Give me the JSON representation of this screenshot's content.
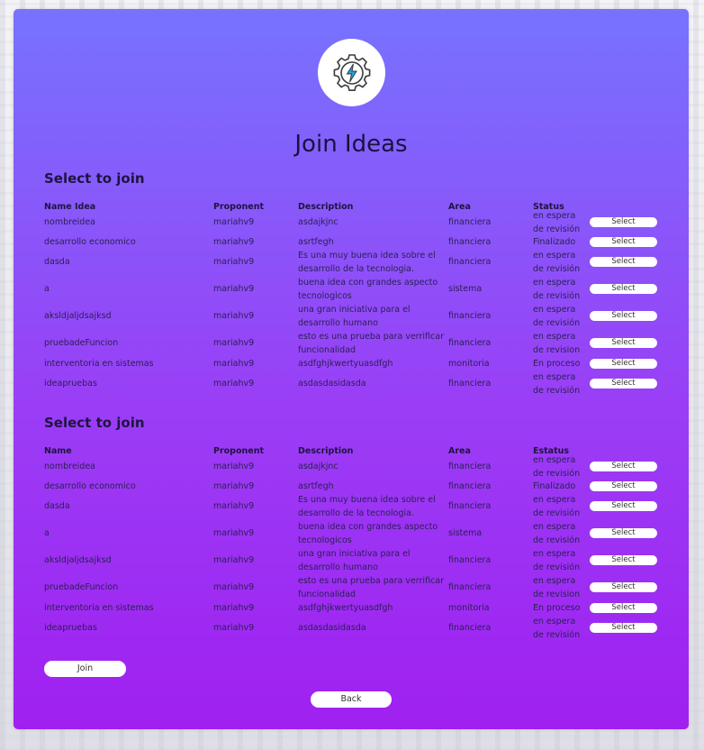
{
  "page_title": "Join Ideas",
  "sections": [
    {
      "title": "Select to join",
      "headers": [
        "Name Idea",
        "Proponent",
        "Description",
        "Area",
        "Status"
      ],
      "rows": [
        {
          "name": "nombreidea",
          "proponent": "mariahv9",
          "description": "asdajkjnc",
          "area": "financiera",
          "status": "en espera de revisión",
          "action": "Select"
        },
        {
          "name": "desarrollo economico",
          "proponent": "mariahv9",
          "description": "asrtfegh",
          "area": "financiera",
          "status": "Finalizado",
          "action": "Select"
        },
        {
          "name": "dasda",
          "proponent": "mariahv9",
          "description": "Es una muy buena idea sobre el desarrollo de la tecnologia.",
          "area": "financiera",
          "status": "en espera de revisión",
          "action": "Select"
        },
        {
          "name": "a",
          "proponent": "mariahv9",
          "description": "buena idea con grandes aspecto tecnologicos",
          "area": "sistema",
          "status": "en espera de revisión",
          "action": "Select"
        },
        {
          "name": "aksldjaljdsajksd",
          "proponent": "mariahv9",
          "description": "una gran iniciativa para el desarrollo humano",
          "area": "financiera",
          "status": "en espera de revisión",
          "action": "Select"
        },
        {
          "name": "pruebadeFuncion",
          "proponent": "mariahv9",
          "description": "esto es una prueba para verrificar funcionalidad",
          "area": "financiera",
          "status": "en espera de revision",
          "action": "Select"
        },
        {
          "name": "interventoria en sistemas",
          "proponent": "mariahv9",
          "description": "asdfghjkwertyuasdfgh",
          "area": "monitoria",
          "status": "En proceso",
          "action": "Select"
        },
        {
          "name": "ideapruebas",
          "proponent": "mariahv9",
          "description": "asdasdasidasda",
          "area": "financiera",
          "status": "en espera de revisión",
          "action": "Select"
        }
      ]
    },
    {
      "title": "Select to join",
      "headers": [
        "Name",
        "Proponent",
        "Description",
        "Area",
        "Estatus"
      ],
      "rows": [
        {
          "name": "nombreidea",
          "proponent": "mariahv9",
          "description": "asdajkjnc",
          "area": "financiera",
          "status": "en espera de revisión",
          "action": "Select"
        },
        {
          "name": "desarrollo economico",
          "proponent": "mariahv9",
          "description": "asrtfegh",
          "area": "financiera",
          "status": "Finalizado",
          "action": "Select"
        },
        {
          "name": "dasda",
          "proponent": "mariahv9",
          "description": "Es una muy buena idea sobre el desarrollo de la tecnologia.",
          "area": "financiera",
          "status": "en espera de revisión",
          "action": "Select"
        },
        {
          "name": "a",
          "proponent": "mariahv9",
          "description": "buena idea con grandes aspecto tecnologicos",
          "area": "sistema",
          "status": "en espera de revisión",
          "action": "Select"
        },
        {
          "name": "aksldjaljdsajksd",
          "proponent": "mariahv9",
          "description": "una gran iniciativa para el desarrollo humano",
          "area": "financiera",
          "status": "en espera de revisión",
          "action": "Select"
        },
        {
          "name": "pruebadeFuncion",
          "proponent": "mariahv9",
          "description": "esto es una prueba para verrificar funcionalidad",
          "area": "financiera",
          "status": "en espera de revision",
          "action": "Select"
        },
        {
          "name": "interventoria en sistemas",
          "proponent": "mariahv9",
          "description": "asdfghjkwertyuasdfgh",
          "area": "monitoria",
          "status": "En proceso",
          "action": "Select"
        },
        {
          "name": "ideapruebas",
          "proponent": "mariahv9",
          "description": "asdasdasidasda",
          "area": "financiera",
          "status": "en espera de revisión",
          "action": "Select"
        }
      ]
    }
  ],
  "join_label": "Join",
  "back_label": "Back",
  "logo_icon": "gear-lightning-icon",
  "colors": {
    "gradient_top": "#7673fe",
    "gradient_bottom": "#a020f0",
    "logo_accent": "#1fa3e0"
  }
}
